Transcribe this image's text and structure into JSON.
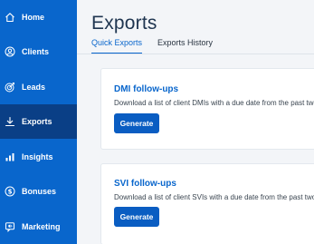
{
  "sidebar": {
    "items": [
      {
        "label": "Home",
        "icon": "home-icon"
      },
      {
        "label": "Clients",
        "icon": "user-circle-icon"
      },
      {
        "label": "Leads",
        "icon": "target-icon"
      },
      {
        "label": "Exports",
        "icon": "download-icon",
        "active": true
      },
      {
        "label": "Insights",
        "icon": "bar-chart-icon"
      },
      {
        "label": "Bonuses",
        "icon": "dollar-circle-icon"
      },
      {
        "label": "Marketing",
        "icon": "megaphone-icon"
      }
    ]
  },
  "main": {
    "title": "Exports",
    "tabs": [
      {
        "label": "Quick Exports",
        "active": true
      },
      {
        "label": "Exports History",
        "active": false
      }
    ],
    "cards": [
      {
        "title": "DMI follow-ups",
        "description": "Download a list of client DMIs with a due date from the past two",
        "button_label": "Generate"
      },
      {
        "title": "SVI follow-ups",
        "description": "Download a list of client SVIs with a due date from the past two",
        "button_label": "Generate"
      }
    ]
  },
  "colors": {
    "sidebar_bg": "#0966cc",
    "sidebar_active": "#0a3f86",
    "accent": "#0966cc",
    "page_bg": "#f3f5f8"
  }
}
